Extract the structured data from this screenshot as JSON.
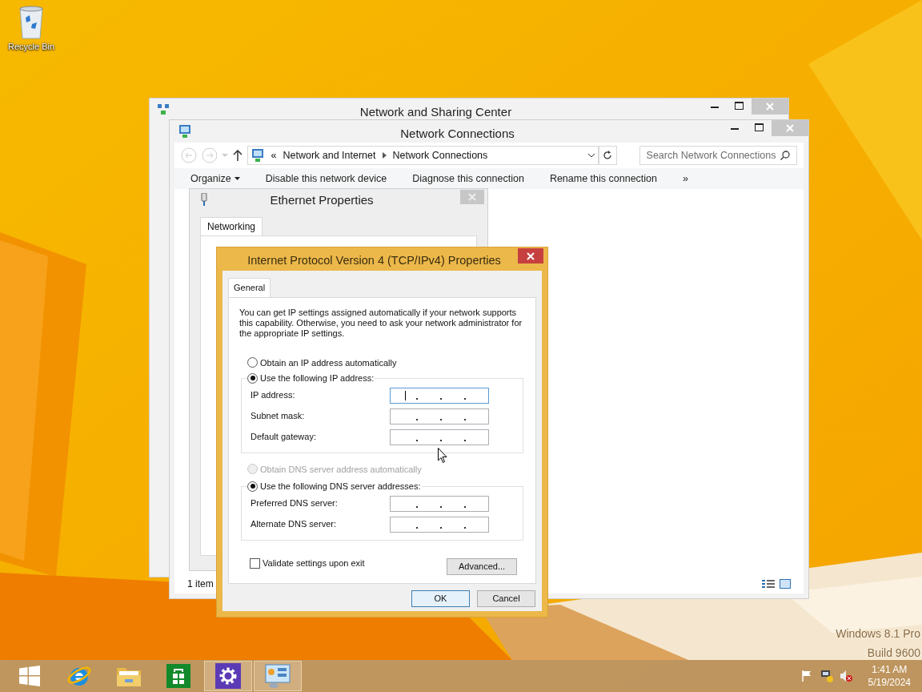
{
  "desktop": {
    "icons": [
      {
        "label": "Recycle Bin"
      }
    ],
    "edition": [
      "Windows 8.1 Pro",
      "Build 9600"
    ]
  },
  "network_sharing_center": {
    "title": "Network and Sharing Center"
  },
  "network_connections": {
    "title": "Network Connections",
    "breadcrumbs": [
      "Network and Internet",
      "Network Connections"
    ],
    "overflow": "«",
    "search": {
      "placeholder": "Search Network Connections"
    },
    "toolbar": [
      {
        "label": "Organize",
        "dropdown": true
      },
      {
        "label": "Disable this network device",
        "dropdown": false
      },
      {
        "label": "Diagnose this connection",
        "dropdown": false
      },
      {
        "label": "Rename this connection",
        "dropdown": false
      },
      {
        "label": "»",
        "dropdown": false
      }
    ],
    "status_bar": "1 item"
  },
  "ethernet_properties": {
    "title": "Ethernet Properties",
    "tabs": [
      {
        "label": "Networking",
        "selected": true
      }
    ]
  },
  "ipv4_dialog": {
    "title": "Internet Protocol Version 4 (TCP/IPv4) Properties",
    "tabs": [
      {
        "label": "General",
        "selected": true
      }
    ],
    "intro": "You can get IP settings assigned automatically if your network supports this capability. Otherwise, you need to ask your network administrator for the appropriate IP settings.",
    "ip_options": [
      {
        "label": "Obtain an IP address automatically",
        "selected": false,
        "disabled": false
      },
      {
        "label": "Use the following IP address:",
        "selected": true,
        "disabled": false
      }
    ],
    "ip_fields": [
      {
        "label": "IP address:",
        "focused": true
      },
      {
        "label": "Subnet mask:",
        "focused": false
      },
      {
        "label": "Default gateway:",
        "focused": false
      }
    ],
    "dns_options": [
      {
        "label": "Obtain DNS server address automatically",
        "selected": false,
        "disabled": true
      },
      {
        "label": "Use the following DNS server addresses:",
        "selected": true,
        "disabled": false
      }
    ],
    "dns_fields": [
      {
        "label": "Preferred DNS server:",
        "focused": false
      },
      {
        "label": "Alternate DNS server:",
        "focused": false
      }
    ],
    "validate": {
      "label": "Validate settings upon exit",
      "checked": false
    },
    "advanced_button": "Advanced...",
    "buttons": [
      {
        "label": "OK",
        "default": true
      },
      {
        "label": "Cancel",
        "default": false
      }
    ]
  },
  "taskbar": {
    "items": [
      {
        "kind": "start",
        "running": false
      },
      {
        "kind": "browser",
        "running": false
      },
      {
        "kind": "explorer",
        "running": false
      },
      {
        "kind": "store",
        "running": false
      },
      {
        "kind": "settings",
        "running": true
      },
      {
        "kind": "control_panel",
        "running": true
      }
    ],
    "time": "1:41 AM",
    "date": "5/19/2024"
  }
}
